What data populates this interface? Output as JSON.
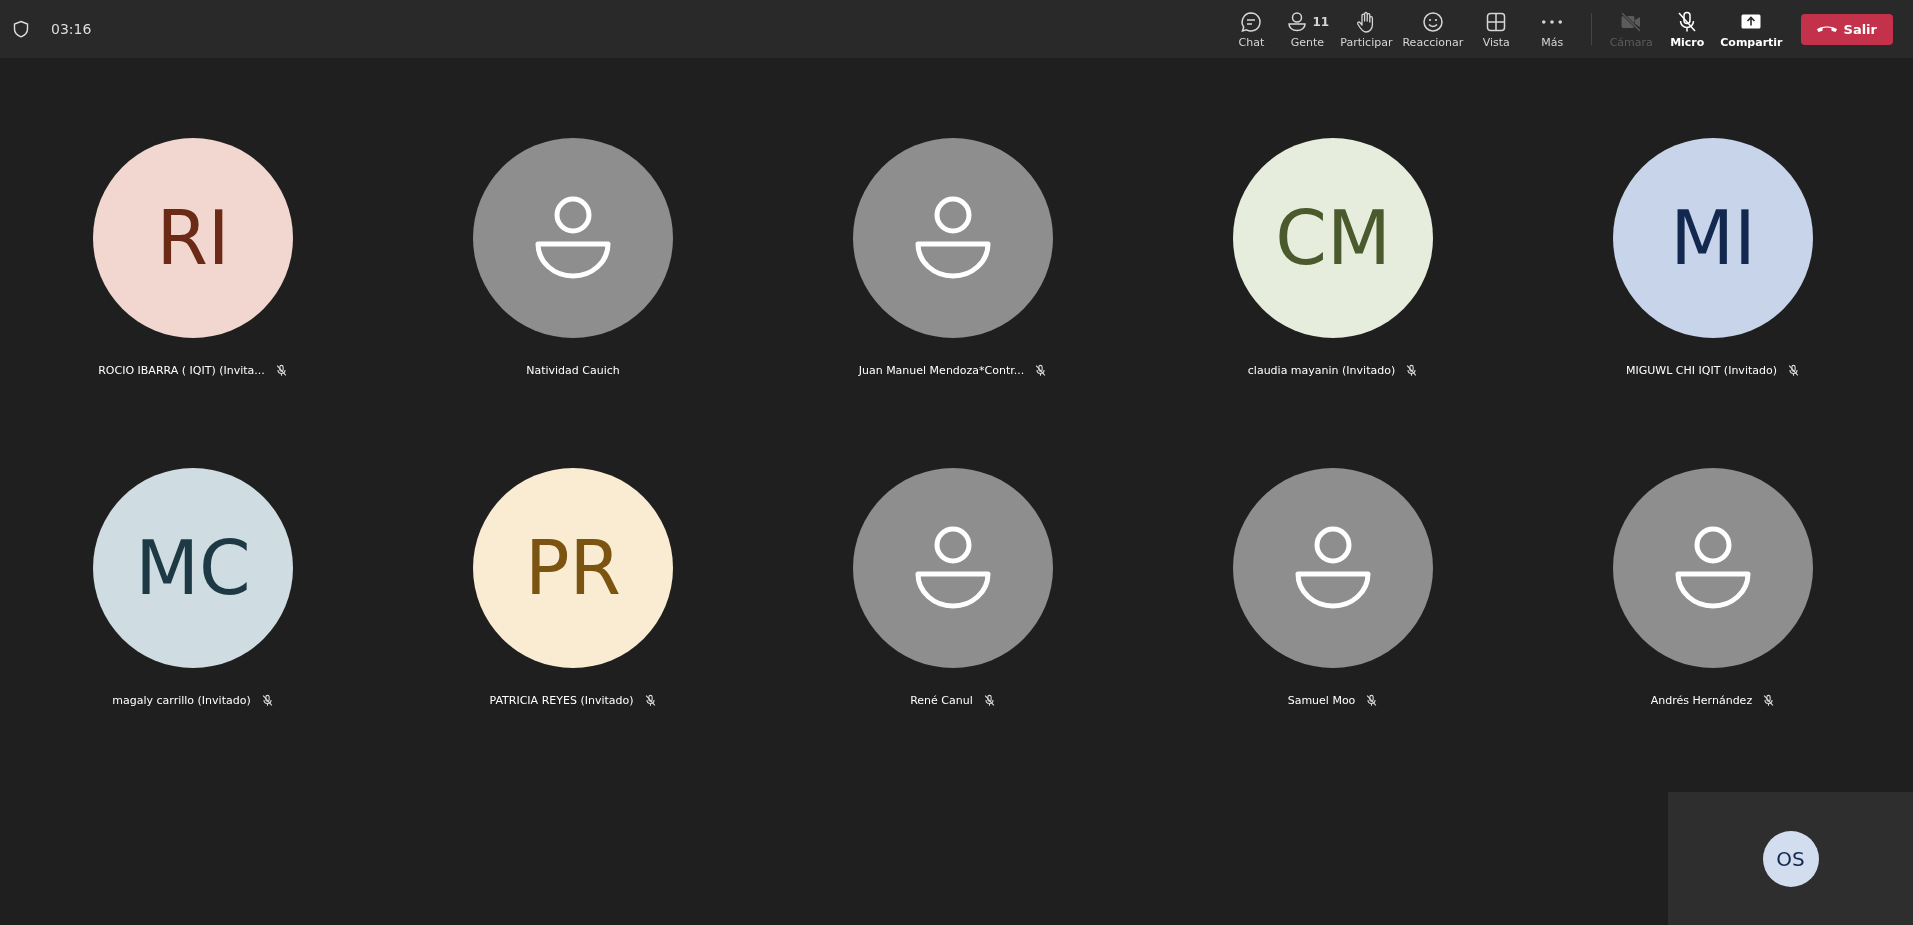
{
  "top_bar": {
    "timer": "03:16"
  },
  "toolbar": [
    {
      "kind": "chat",
      "label": "Chat",
      "disabled": false
    },
    {
      "kind": "people",
      "label": "Gente",
      "count": "11",
      "disabled": false
    },
    {
      "kind": "hand",
      "label": "Participar",
      "disabled": false
    },
    {
      "kind": "react",
      "label": "Reaccionar",
      "disabled": false
    },
    {
      "kind": "view",
      "label": "Vista",
      "disabled": false
    },
    {
      "kind": "more",
      "label": "Más",
      "disabled": false
    },
    {
      "kind": "camera",
      "label": "Cámara",
      "disabled": true
    },
    {
      "kind": "mic",
      "label": "Micro",
      "disabled": false
    },
    {
      "kind": "share",
      "label": "Compartir",
      "disabled": false
    }
  ],
  "leave_button": {
    "label": "Salir"
  },
  "participants": [
    {
      "name": "ROCIO IBARRA ( IQIT) (Invita...",
      "initials": "RI",
      "color": "#f2d7d0",
      "muted": true
    },
    {
      "name": "Natividad Cauich",
      "muted": false
    },
    {
      "name": "Juan Manuel Mendoza*Contr...",
      "muted": true
    },
    {
      "name": "claudia mayanin (Invitado)",
      "initials": "CM",
      "color": "#e6eddc",
      "muted": true
    },
    {
      "name": "MIGUWL CHI IQIT (Invitado)",
      "initials": "MI",
      "color": "#c8d4ea",
      "muted": true
    },
    {
      "name": "magaly carrillo (Invitado)",
      "initials": "MC",
      "color": "#cfdce2",
      "muted": true
    },
    {
      "name": "PATRICIA REYES (Invitado)",
      "initials": "PR",
      "color": "#f9ecd2",
      "muted": true
    },
    {
      "name": "René Canul",
      "muted": true
    },
    {
      "name": "Samuel Moo",
      "muted": true
    },
    {
      "name": "Andrés Hernández",
      "muted": true
    }
  ],
  "self_view": {
    "initials": "OS"
  }
}
